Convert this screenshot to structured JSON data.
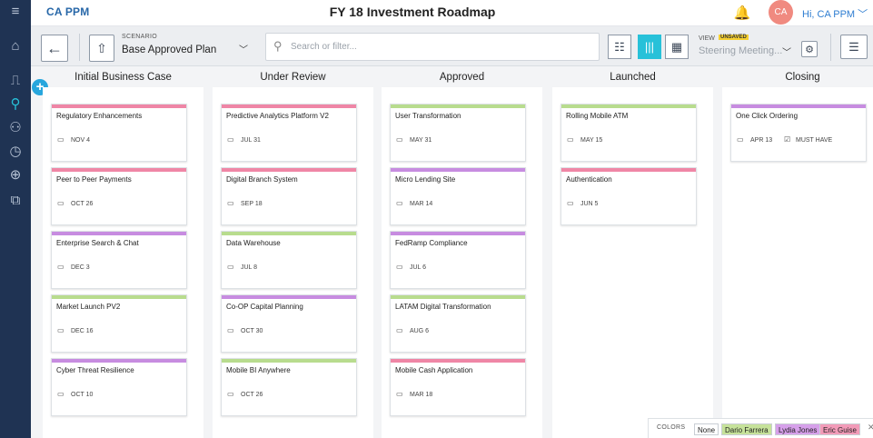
{
  "app": {
    "brand": "CA PPM",
    "title": "FY 18 Investment Roadmap",
    "avatar_initials": "CA",
    "greeting": "Hi, CA PPM",
    "greeting_chevron": "﹀"
  },
  "rail": {
    "icons": [
      "menu-icon",
      "home-icon",
      "dashboard-icon",
      "roadmap-icon",
      "users-icon",
      "clock-icon",
      "globe-icon",
      "export-icon"
    ],
    "glyphs": [
      "≡",
      "⌂",
      "⎍",
      "⚲",
      "⚇",
      "◷",
      "⊕",
      "⧉"
    ]
  },
  "toolbar": {
    "back_glyph": "←",
    "scenario_icon_glyph": "⇧",
    "scenario_label": "SCENARIO",
    "scenario_value": "Base Approved Plan",
    "scenario_chevron": "﹀",
    "search_placeholder": "Search or filter...",
    "search_glyph": "⚲",
    "view_glyphs": [
      "☷",
      "|||",
      "▦"
    ],
    "view_label": "VIEW",
    "unsaved_badge": "UNSAVED",
    "view_value": "Steering Meeting...",
    "view_chevron": "﹀",
    "gear_glyph": "⚙",
    "list_glyph": "☰"
  },
  "board": {
    "add_glyph": "+",
    "calendar_glyph": "▭",
    "check_glyph": "☑",
    "columns": [
      {
        "title": "Initial Business Case",
        "cards": [
          {
            "name": "Regulatory Enhancements",
            "date": "NOV 4",
            "color": "#ef86a6"
          },
          {
            "name": "Peer to Peer Payments",
            "date": "OCT 26",
            "color": "#ef86a6"
          },
          {
            "name": "Enterprise Search & Chat",
            "date": "DEC 3",
            "color": "#c78ce0"
          },
          {
            "name": "Market Launch PV2",
            "date": "DEC 16",
            "color": "#b8dc8e"
          },
          {
            "name": "Cyber Threat Resilience",
            "date": "OCT 10",
            "color": "#c78ce0"
          }
        ]
      },
      {
        "title": "Under Review",
        "cards": [
          {
            "name": "Predictive Analytics Platform V2",
            "date": "JUL 31",
            "color": "#ef86a6"
          },
          {
            "name": "Digital Branch System",
            "date": "SEP 18",
            "color": "#ef86a6"
          },
          {
            "name": "Data Warehouse",
            "date": "JUL 8",
            "color": "#b8dc8e"
          },
          {
            "name": "Co-OP Capital Planning",
            "date": "OCT 30",
            "color": "#c78ce0"
          },
          {
            "name": "Mobile BI Anywhere",
            "date": "OCT 26",
            "color": "#b8dc8e"
          }
        ]
      },
      {
        "title": "Approved",
        "cards": [
          {
            "name": "User Transformation",
            "date": "MAY 31",
            "color": "#b8dc8e"
          },
          {
            "name": "Micro Lending Site",
            "date": "MAR 14",
            "color": "#c78ce0"
          },
          {
            "name": "FedRamp Compliance",
            "date": "JUL 6",
            "color": "#c78ce0"
          },
          {
            "name": "LATAM Digital Transformation",
            "date": "AUG 6",
            "color": "#b8dc8e"
          },
          {
            "name": "Mobile Cash Application",
            "date": "MAR 18",
            "color": "#ef86a6"
          }
        ]
      },
      {
        "title": "Launched",
        "cards": [
          {
            "name": "Rolling Mobile ATM",
            "date": "MAY 15",
            "color": "#b8dc8e"
          },
          {
            "name": "Authentication",
            "date": "JUN 5",
            "color": "#ef86a6"
          }
        ]
      },
      {
        "title": "Closing",
        "cards": [
          {
            "name": "One Click Ordering",
            "date": "APR 13",
            "color": "#c78ce0",
            "tag": "MUST HAVE"
          }
        ]
      }
    ]
  },
  "legend": {
    "title": "COLORS",
    "close_glyph": "✕",
    "items": [
      {
        "label": "None",
        "color": "#ffffff"
      },
      {
        "label": "Dario Farrera",
        "color": "#c6e29a"
      },
      {
        "label": "Lydia Jones",
        "color": "#d6a0ea"
      },
      {
        "label": "Eric Guise",
        "color": "#f29bb8"
      }
    ]
  }
}
